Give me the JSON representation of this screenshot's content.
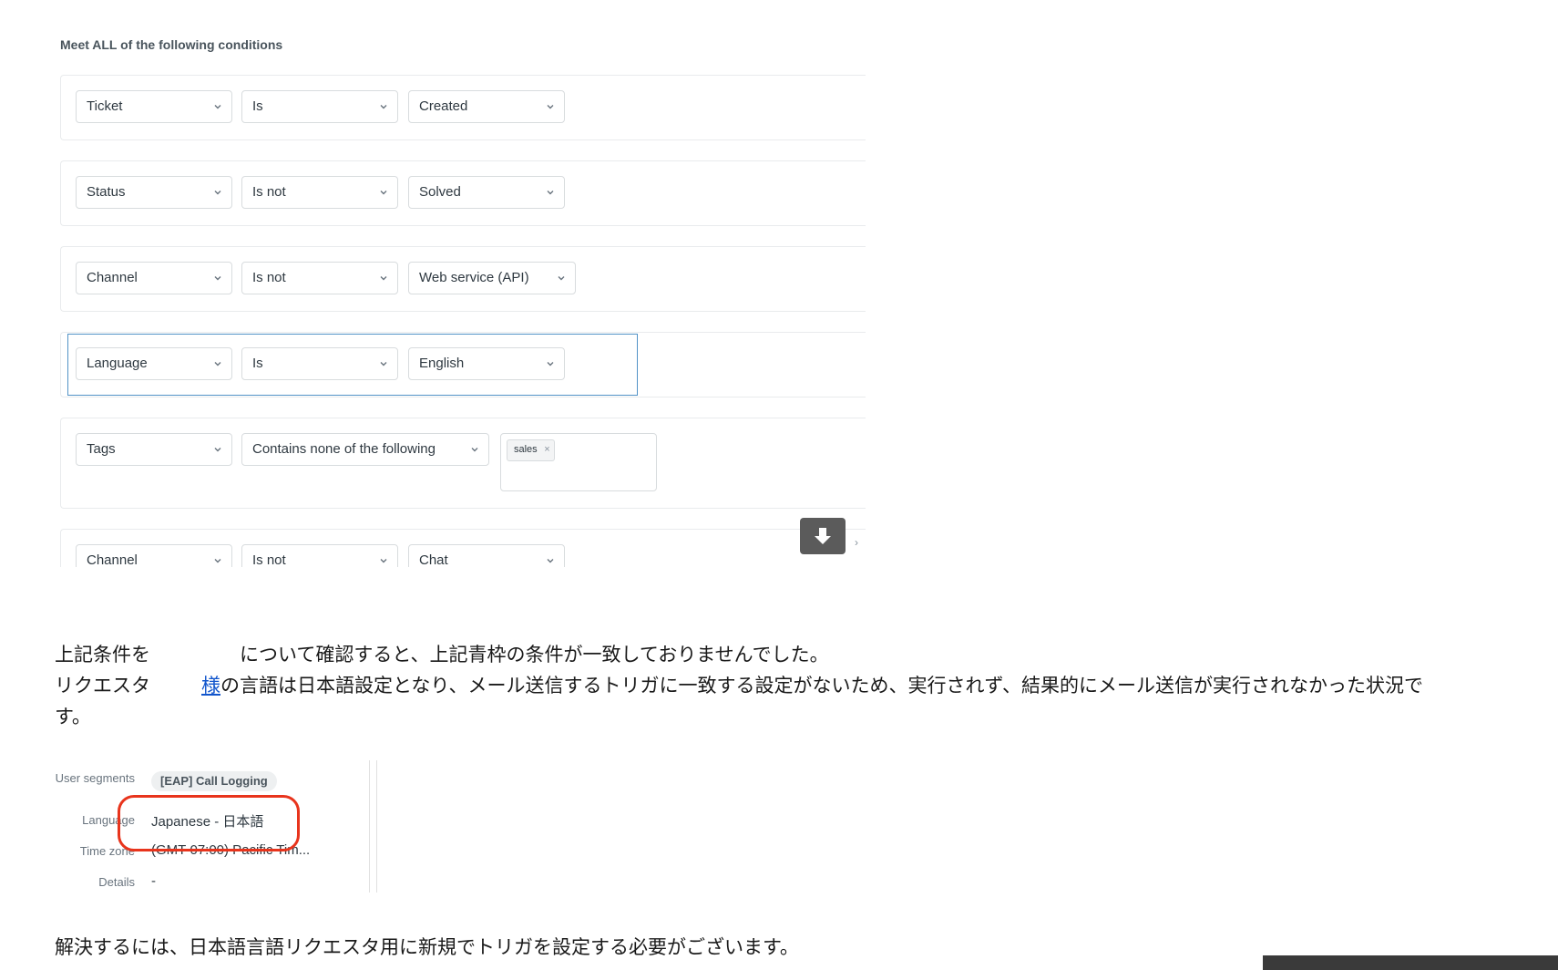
{
  "conditions": {
    "heading": "Meet ALL of the following conditions",
    "rows": [
      {
        "field": "Ticket",
        "operator": "Is",
        "value": "Created"
      },
      {
        "field": "Status",
        "operator": "Is not",
        "value": "Solved"
      },
      {
        "field": "Channel",
        "operator": "Is not",
        "value": "Web service (API)"
      },
      {
        "field": "Language",
        "operator": "Is",
        "value": "English"
      },
      {
        "field": "Tags",
        "operator": "Contains none of the following",
        "tag": "sales",
        "tag_remove": "×"
      },
      {
        "field": "Channel",
        "operator": "Is not",
        "value": "Chat"
      }
    ]
  },
  "text": {
    "line1a": "上記条件を",
    "line1b": "について確認すると、上記青枠の条件が一致しておりませんでした。",
    "line2a": "リクエスタ",
    "line2link": "様",
    "line2b": "の言語は日本語設定となり、メール送信するトリガに一致する設定がないため、実行されず、結果的にメール送信が実行されなかった状況で",
    "line3": "す。",
    "line4": "解決するには、日本語言語リクエスタ用に新規でトリガを設定する必要がございます。"
  },
  "profile": {
    "user_segments_label": "User segments",
    "user_segments_value": "[EAP] Call Logging",
    "language_label": "Language",
    "language_value": "Japanese - 日本語",
    "timezone_label": "Time zone",
    "timezone_value": "(GMT-07:00) Pacific Tim...",
    "details_label": "Details",
    "details_value": "-"
  },
  "colors": {
    "highlight_border": "#5293c7",
    "annotation_ring": "#e8341c",
    "link": "#1155cc",
    "download_button": "#5b5b5b"
  },
  "icons": {
    "dropdown": "chevron-down-icon",
    "download": "download-arrow-icon",
    "tag_remove": "close-icon"
  }
}
